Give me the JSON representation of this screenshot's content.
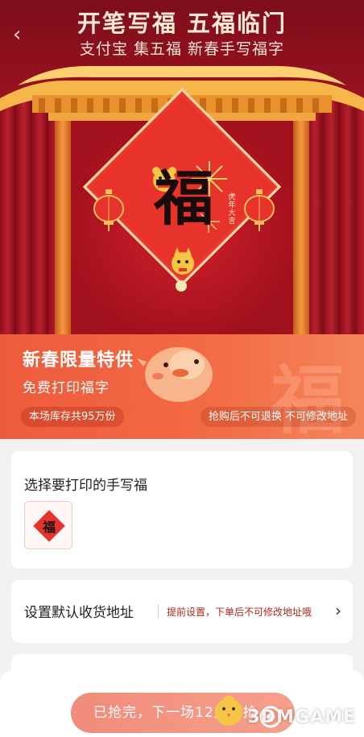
{
  "hero": {
    "title": "开笔写福  五福临门",
    "subtitle": "支付宝 集五福 新春手写福字",
    "fu_character": "福",
    "stamp_text": "虎年大吉"
  },
  "promo": {
    "title": "新春限量特供",
    "subtitle": "免费打印福字",
    "stock": "本场库存共95万份",
    "notice": "抢购后不可退换 不可修改地址",
    "bg_character": "福"
  },
  "select_card": {
    "title": "选择要打印的手写福",
    "thumb_character": "福"
  },
  "address_card": {
    "title": "设置默认收货地址",
    "hint": "提前设置，下单后不可修改地址哦"
  },
  "bottom": {
    "button_label": "已抢完，下一场12点开抢"
  },
  "watermark": "3DMGAME",
  "icons": {
    "back": "chevron-left-icon",
    "chevron": "chevron-right-icon"
  },
  "colors": {
    "hero_red": "#a3121d",
    "promo_orange": "#f26a43",
    "button_pink": "#f5a08c",
    "hint_red": "#b3261e"
  }
}
